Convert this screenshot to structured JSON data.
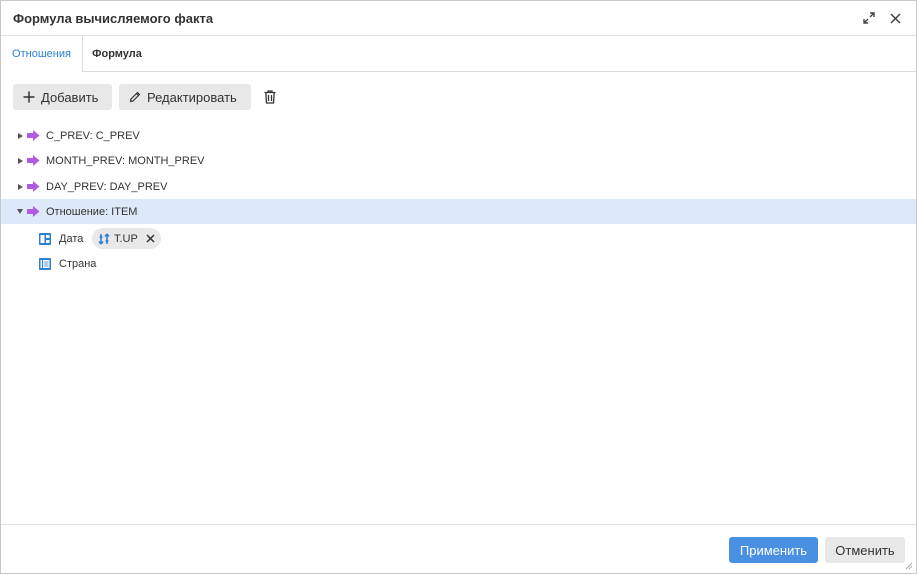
{
  "dialog": {
    "title": "Формула вычисляемого факта"
  },
  "tabs": [
    {
      "label": "Отношения",
      "active": true
    },
    {
      "label": "Формула",
      "active": false
    }
  ],
  "toolbar": {
    "add_label": "Добавить",
    "edit_label": "Редактировать",
    "delete_icon": "trash-icon"
  },
  "tree": {
    "items": [
      {
        "label": "C_PREV: C_PREV",
        "expanded": false,
        "icon": "relation-arrow-icon"
      },
      {
        "label": "MONTH_PREV: MONTH_PREV",
        "expanded": false,
        "icon": "relation-arrow-icon"
      },
      {
        "label": "DAY_PREV: DAY_PREV",
        "expanded": false,
        "icon": "relation-arrow-icon"
      },
      {
        "label": "Отношение: ITEM",
        "expanded": true,
        "selected": true,
        "icon": "relation-arrow-icon"
      }
    ],
    "children": [
      {
        "label": "Дата",
        "icon": "calendar-dimension-icon",
        "chip": {
          "label": "T.UP",
          "icon": "sort-icon"
        }
      },
      {
        "label": "Страна",
        "icon": "dictionary-icon"
      }
    ]
  },
  "footer": {
    "apply_label": "Применить",
    "cancel_label": "Отменить"
  },
  "colors": {
    "accent": "#4a90e2",
    "selected_row": "#dde9f8",
    "relation_icon": "#b15be3",
    "dimension_icon": "#2d7fd5"
  }
}
